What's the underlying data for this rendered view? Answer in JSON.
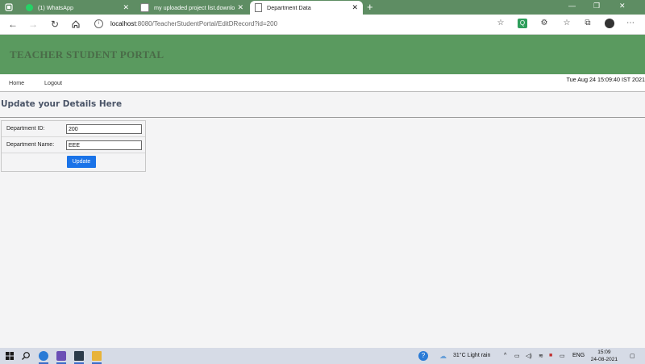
{
  "browser": {
    "tabs": [
      {
        "label": "(1) WhatsApp",
        "active": false
      },
      {
        "label": "my uploaded project list.downlo",
        "active": false
      },
      {
        "label": "Department Data",
        "active": true
      }
    ],
    "url_host": "localhost",
    "url_path": ":8080/TeacherStudentPortal/EditDRecord?id=200"
  },
  "banner": {
    "title": "TEACHER STUDENT PORTAL"
  },
  "nav": {
    "home": "Home",
    "logout": "Logout",
    "clock": "Tue Aug 24 15:09:40 IST 2021"
  },
  "page": {
    "heading": "Update your Details Here"
  },
  "form": {
    "dept_id_label": "Department ID:",
    "dept_id_value": "200",
    "dept_name_label": "Department Name:",
    "dept_name_value": "EEE",
    "update_label": "Update"
  },
  "taskbar": {
    "weather": "31°C  Light rain",
    "lang": "ENG",
    "time": "15:09",
    "date": "24-08-2021"
  },
  "colors": {
    "banner": "#5a9a5f",
    "button": "#1a73e8",
    "tabbar": "#5e8d63"
  }
}
